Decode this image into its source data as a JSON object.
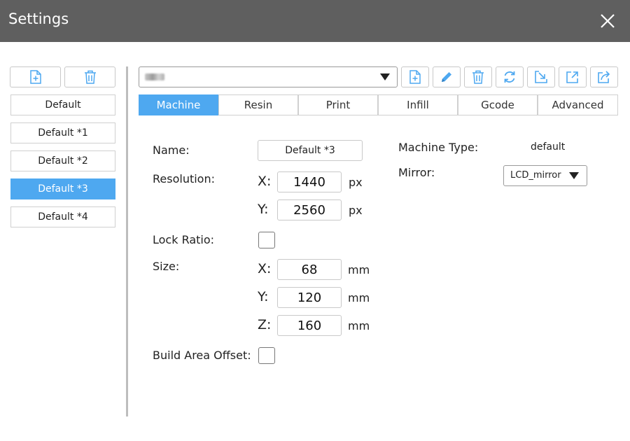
{
  "window": {
    "title": "Settings",
    "close_icon": "close-icon"
  },
  "sidebar": {
    "toolbar": [
      {
        "icon": "new-file-icon"
      },
      {
        "icon": "trash-icon"
      }
    ],
    "profiles": [
      {
        "label": "Default",
        "selected": false
      },
      {
        "label": "Default *1",
        "selected": false
      },
      {
        "label": "Default *2",
        "selected": false
      },
      {
        "label": "Default *3",
        "selected": true
      },
      {
        "label": "Default *4",
        "selected": false
      }
    ]
  },
  "toolbar": {
    "printer_select_value": "",
    "icons": [
      "new-file-icon",
      "pencil-icon",
      "trash-icon",
      "refresh-icon",
      "import-icon",
      "export-icon",
      "share-icon"
    ]
  },
  "tabs": [
    {
      "label": "Machine",
      "active": true
    },
    {
      "label": "Resin",
      "active": false
    },
    {
      "label": "Print",
      "active": false
    },
    {
      "label": "Infill",
      "active": false
    },
    {
      "label": "Gcode",
      "active": false
    },
    {
      "label": "Advanced",
      "active": false
    }
  ],
  "machine": {
    "name_label": "Name:",
    "name_value": "Default *3",
    "resolution_label": "Resolution:",
    "resolution": {
      "x_label": "X:",
      "x_value": "1440",
      "x_unit": "px",
      "y_label": "Y:",
      "y_value": "2560",
      "y_unit": "px"
    },
    "lock_ratio_label": "Lock Ratio:",
    "lock_ratio_checked": false,
    "size_label": "Size:",
    "size": {
      "x_label": "X:",
      "x_value": "68",
      "x_unit": "mm",
      "y_label": "Y:",
      "y_value": "120",
      "y_unit": "mm",
      "z_label": "Z:",
      "z_value": "160",
      "z_unit": "mm"
    },
    "build_area_offset_label": "Build Area Offset:",
    "build_area_offset_checked": false,
    "machine_type_label": "Machine Type:",
    "machine_type_value": "default",
    "mirror_label": "Mirror:",
    "mirror_value": "LCD_mirror"
  },
  "colors": {
    "titlebar": "#5f5f5f",
    "accent": "#4ea8f0",
    "border": "#c8c8c8",
    "divider": "#bdbdbd"
  }
}
